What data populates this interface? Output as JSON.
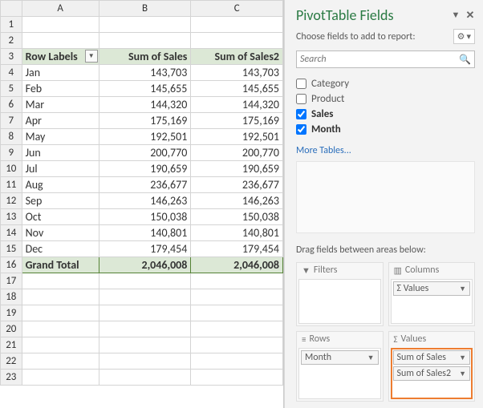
{
  "columns": [
    "A",
    "B",
    "C"
  ],
  "headers": {
    "row_labels": "Row Labels",
    "sum1": "Sum of Sales",
    "sum2": "Sum of Sales2"
  },
  "rows": [
    {
      "m": "Jan",
      "v1": "143,703",
      "v2": "143,703"
    },
    {
      "m": "Feb",
      "v1": "145,655",
      "v2": "145,655"
    },
    {
      "m": "Mar",
      "v1": "144,320",
      "v2": "144,320"
    },
    {
      "m": "Apr",
      "v1": "175,169",
      "v2": "175,169"
    },
    {
      "m": "May",
      "v1": "192,501",
      "v2": "192,501"
    },
    {
      "m": "Jun",
      "v1": "200,770",
      "v2": "200,770"
    },
    {
      "m": "Jul",
      "v1": "190,659",
      "v2": "190,659"
    },
    {
      "m": "Aug",
      "v1": "236,677",
      "v2": "236,677"
    },
    {
      "m": "Sep",
      "v1": "146,263",
      "v2": "146,263"
    },
    {
      "m": "Oct",
      "v1": "150,038",
      "v2": "150,038"
    },
    {
      "m": "Nov",
      "v1": "140,801",
      "v2": "140,801"
    },
    {
      "m": "Dec",
      "v1": "179,454",
      "v2": "179,454"
    }
  ],
  "grand_total": {
    "label": "Grand Total",
    "v1": "2,046,008",
    "v2": "2,046,008"
  },
  "pane": {
    "title": "PivotTable Fields",
    "choose": "Choose fields to add to report:",
    "search_ph": "Search",
    "fields": [
      {
        "label": "Category",
        "checked": false
      },
      {
        "label": "Product",
        "checked": false
      },
      {
        "label": "Sales",
        "checked": true
      },
      {
        "label": "Month",
        "checked": true
      }
    ],
    "more": "More Tables...",
    "drag": "Drag fields between areas below:",
    "area_filters": "Filters",
    "area_columns": "Columns",
    "area_rows": "Rows",
    "area_values": "Values",
    "cols_chip": "Values",
    "rows_chip": "Month",
    "vals_chip1": "Sum of Sales",
    "vals_chip2": "Sum of Sales2",
    "sigma": "Σ"
  },
  "chart_data": {
    "type": "table",
    "categories": [
      "Jan",
      "Feb",
      "Mar",
      "Apr",
      "May",
      "Jun",
      "Jul",
      "Aug",
      "Sep",
      "Oct",
      "Nov",
      "Dec"
    ],
    "series": [
      {
        "name": "Sum of Sales",
        "values": [
          143703,
          145655,
          144320,
          175169,
          192501,
          200770,
          190659,
          236677,
          146263,
          150038,
          140801,
          179454
        ]
      },
      {
        "name": "Sum of Sales2",
        "values": [
          143703,
          145655,
          144320,
          175169,
          192501,
          200770,
          190659,
          236677,
          146263,
          150038,
          140801,
          179454
        ]
      }
    ],
    "totals": {
      "Sum of Sales": 2046008,
      "Sum of Sales2": 2046008
    },
    "title": "PivotTable"
  }
}
